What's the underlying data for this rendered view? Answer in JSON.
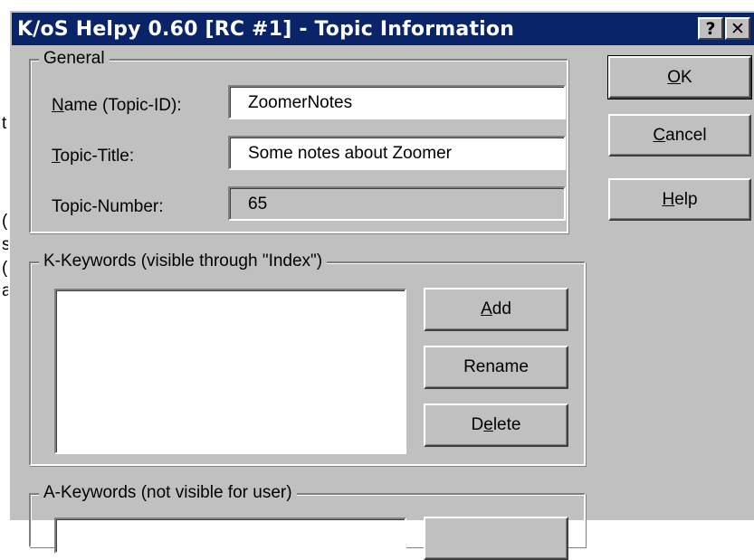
{
  "background": {
    "fragments": [
      "t",
      "(",
      "s",
      "(",
      "a"
    ]
  },
  "dialog": {
    "title": "K/oS Helpy 0.60 [RC #1] - Topic Information",
    "help_glyph": "?",
    "close_glyph": "✕"
  },
  "general": {
    "legend": "General",
    "name_label_ul": "N",
    "name_label_rest": "ame (Topic-ID):",
    "name_value": "ZoomerNotes",
    "title_label_ul": "T",
    "title_label_rest": "opic-Title:",
    "title_value": "Some notes about Zoomer",
    "number_label": "Topic-Number:",
    "number_value": "65"
  },
  "buttons": {
    "ok_ul": "O",
    "ok_rest": "K",
    "cancel_ul": "C",
    "cancel_rest": "ancel",
    "help_ul": "H",
    "help_rest": "elp"
  },
  "k_keywords": {
    "legend": "K-Keywords (visible through \"Index\")",
    "add_ul": "A",
    "add_rest": "dd",
    "rename_label": "Rename",
    "delete_pre": "D",
    "delete_ul": "e",
    "delete_rest": "lete"
  },
  "a_keywords": {
    "legend": "A-Keywords (not visible for user)"
  }
}
